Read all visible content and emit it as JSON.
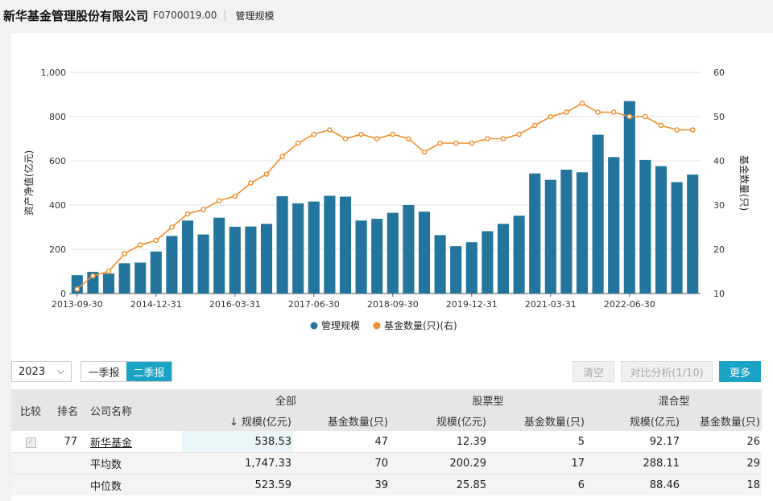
{
  "header": {
    "company_name": "新华基金管理股份有限公司",
    "company_code": "F0700019.00",
    "tab": "管理规模"
  },
  "colors": {
    "bar": "#23759e",
    "line": "#f28e2b",
    "accent": "#1aa3c4"
  },
  "chart_data": {
    "type": "bar",
    "x_tick_labels": [
      "2013-09-30",
      "2014-12-31",
      "2016-03-31",
      "2017-06-30",
      "2018-09-30",
      "2019-12-31",
      "2021-03-31",
      "2022-06-30"
    ],
    "series": [
      {
        "name": "管理规模",
        "type": "bar",
        "axis": "left",
        "values": [
          83,
          98,
          90,
          137,
          140,
          190,
          260,
          330,
          267,
          343,
          302,
          303,
          315,
          440,
          408,
          416,
          442,
          438,
          330,
          338,
          365,
          400,
          370,
          264,
          214,
          232,
          282,
          315,
          352,
          543,
          514,
          560,
          548,
          718,
          617,
          870,
          604,
          576,
          504,
          538
        ]
      },
      {
        "name": "基金数量(只)(右)",
        "type": "line",
        "axis": "right",
        "values": [
          11,
          14,
          15,
          19,
          21,
          22,
          25,
          28,
          29,
          31,
          32,
          35,
          37,
          41,
          44,
          46,
          47,
          45,
          46,
          45,
          46,
          45,
          42,
          44,
          44,
          44,
          45,
          45,
          46,
          48,
          50,
          51,
          53,
          51,
          51,
          50,
          50,
          48,
          47,
          47
        ]
      }
    ],
    "y_left": {
      "label": "资产净值(亿元)",
      "ticks": [
        "0",
        "200",
        "400",
        "600",
        "800",
        "1,000"
      ],
      "range": [
        0,
        1000
      ]
    },
    "y_right": {
      "label": "基金数量(只)",
      "ticks": [
        "10",
        "20",
        "30",
        "40",
        "50",
        "60"
      ],
      "range": [
        10,
        60
      ]
    },
    "legend": {
      "position": "bottom",
      "items": [
        "管理规模",
        "基金数量(只)(右)"
      ]
    },
    "grid": true
  },
  "controls": {
    "year": "2023",
    "quarters": [
      "一季报",
      "二季报"
    ],
    "active_quarter": "二季报",
    "clear": "清空",
    "compare": "对比分析(1/10)",
    "more": "更多"
  },
  "table": {
    "header_compare": "比较",
    "header_rank": "排名",
    "header_name": "公司名称",
    "groups": [
      "全部",
      "股票型",
      "混合型"
    ],
    "sub_scale_sorted": "↓ 规模(亿元)",
    "sub_scale": "规模(亿元)",
    "sub_count": "基金数量(只)",
    "rows": [
      {
        "rank": "77",
        "name": "新华基金",
        "all_scale": "538.53",
        "all_count": "47",
        "stock_scale": "12.39",
        "stock_count": "5",
        "mixed_scale": "92.17",
        "mixed_count": "26"
      },
      {
        "rank": "",
        "name": "平均数",
        "all_scale": "1,747.33",
        "all_count": "70",
        "stock_scale": "200.29",
        "stock_count": "17",
        "mixed_scale": "288.11",
        "mixed_count": "29"
      },
      {
        "rank": "",
        "name": "中位数",
        "all_scale": "523.59",
        "all_count": "39",
        "stock_scale": "25.85",
        "stock_count": "6",
        "mixed_scale": "88.46",
        "mixed_count": "18"
      }
    ]
  }
}
